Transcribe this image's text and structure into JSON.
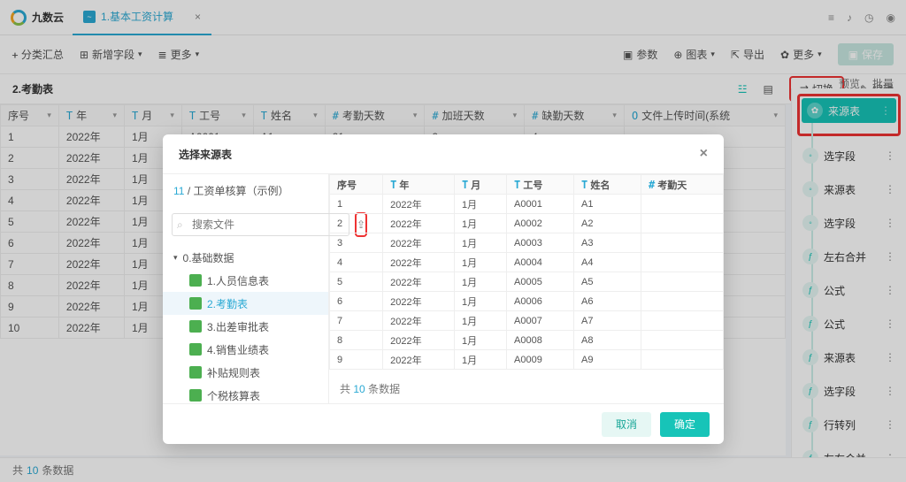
{
  "app": {
    "name": "九数云",
    "tab_label": "1.基本工资计算"
  },
  "top_icons": [
    "list",
    "bell",
    "clock",
    "user"
  ],
  "toolbar": {
    "group": "分类汇总",
    "addfield": "新增字段",
    "more": "更多",
    "params": "参数",
    "chart": "图表",
    "export": "导出",
    "more2": "更多",
    "save": "保存"
  },
  "subhead": {
    "title": "2.考勤表",
    "switch": "切换",
    "edit": "编辑",
    "preview": "预览",
    "batch": "批量"
  },
  "grid": {
    "head": [
      "序号",
      "年",
      "月",
      "工号",
      "姓名",
      "考勤天数",
      "加班天数",
      "缺勤天数",
      "文件上传时间(系统"
    ],
    "types": [
      "",
      "T",
      "T",
      "T",
      "T",
      "#",
      "#",
      "#",
      "O"
    ],
    "rows": [
      [
        "1",
        "2022年",
        "1月",
        "A0001",
        "A1",
        "21",
        "2",
        "4",
        ""
      ],
      [
        "2",
        "2022年",
        "1月",
        "",
        "",
        "",
        "",
        "",
        ""
      ],
      [
        "3",
        "2022年",
        "1月",
        "",
        "",
        "",
        "",
        "",
        ""
      ],
      [
        "4",
        "2022年",
        "1月",
        "",
        "",
        "",
        "",
        "",
        ""
      ],
      [
        "5",
        "2022年",
        "1月",
        "",
        "",
        "",
        "",
        "",
        ""
      ],
      [
        "6",
        "2022年",
        "1月",
        "",
        "",
        "",
        "",
        "",
        ""
      ],
      [
        "7",
        "2022年",
        "1月",
        "",
        "",
        "",
        "",
        "",
        ""
      ],
      [
        "8",
        "2022年",
        "1月",
        "",
        "",
        "",
        "",
        "",
        ""
      ],
      [
        "9",
        "2022年",
        "1月",
        "",
        "",
        "",
        "",
        "",
        ""
      ],
      [
        "10",
        "2022年",
        "1月",
        "",
        "",
        "",
        "",
        "",
        ""
      ]
    ]
  },
  "footer": {
    "prefix": "共",
    "count": "10",
    "suffix": "条数据"
  },
  "flow": {
    "steps": [
      "来源表",
      "选字段",
      "来源表",
      "选字段",
      "左右合并",
      "公式",
      "公式",
      "来源表",
      "选字段",
      "行转列",
      "左右合并"
    ]
  },
  "modal": {
    "title": "选择来源表",
    "crumb_num": "11",
    "crumb_sep": "/",
    "crumb_text": "工资单核算（示例）",
    "search_placeholder": "搜索文件",
    "tree_folder": "0.基础数据",
    "tree_files": [
      "1.人员信息表",
      "2.考勤表",
      "3.出差审批表",
      "4.销售业绩表",
      "补贴规则表",
      "个税核算表"
    ],
    "tree_selected_index": 1,
    "preview_head": [
      "序号",
      "年",
      "月",
      "工号",
      "姓名",
      "考勤天"
    ],
    "preview_types": [
      "",
      "T",
      "T",
      "T",
      "T",
      "#"
    ],
    "preview_rows": [
      [
        "1",
        "2022年",
        "1月",
        "A0001",
        "A1"
      ],
      [
        "2",
        "2022年",
        "1月",
        "A0002",
        "A2"
      ],
      [
        "3",
        "2022年",
        "1月",
        "A0003",
        "A3"
      ],
      [
        "4",
        "2022年",
        "1月",
        "A0004",
        "A4"
      ],
      [
        "5",
        "2022年",
        "1月",
        "A0005",
        "A5"
      ],
      [
        "6",
        "2022年",
        "1月",
        "A0006",
        "A6"
      ],
      [
        "7",
        "2022年",
        "1月",
        "A0007",
        "A7"
      ],
      [
        "8",
        "2022年",
        "1月",
        "A0008",
        "A8"
      ],
      [
        "9",
        "2022年",
        "1月",
        "A0009",
        "A9"
      ]
    ],
    "foot_prefix": "共",
    "foot_count": "10",
    "foot_suffix": "条数据",
    "cancel": "取消",
    "ok": "确定"
  }
}
